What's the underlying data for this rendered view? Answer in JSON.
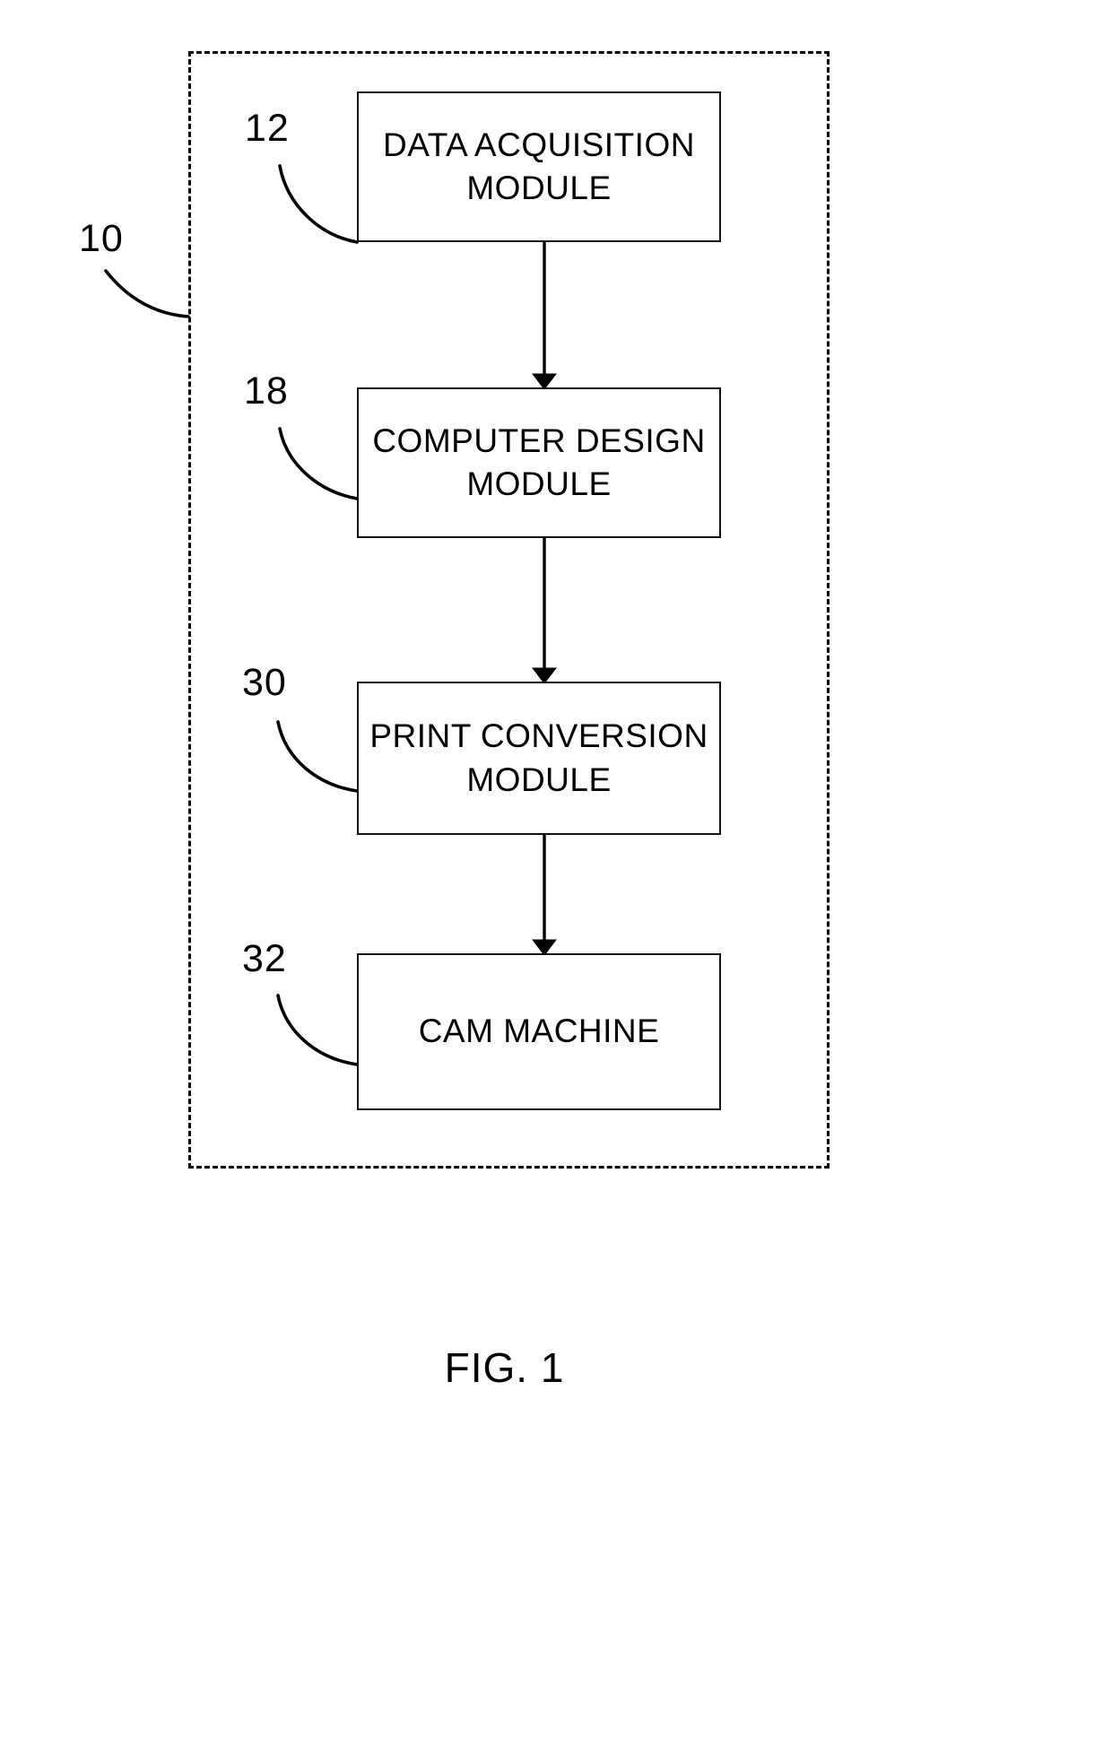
{
  "figure": {
    "caption": "FIG. 1",
    "system_reference": "10"
  },
  "diagram": {
    "type": "flowchart",
    "orientation": "vertical",
    "boundary": {
      "style": "dashed",
      "reference": "10",
      "description": "system boundary"
    },
    "nodes": [
      {
        "id": "data-acquisition",
        "reference": "12",
        "label": "DATA ACQUISITION\nMODULE"
      },
      {
        "id": "computer-design",
        "reference": "18",
        "label": "COMPUTER DESIGN\nMODULE"
      },
      {
        "id": "print-conversion",
        "reference": "30",
        "label": "PRINT CONVERSION\nMODULE"
      },
      {
        "id": "cam-machine",
        "reference": "32",
        "label": "CAM MACHINE"
      }
    ],
    "edges": [
      {
        "from": "data-acquisition",
        "to": "computer-design",
        "arrow": "down"
      },
      {
        "from": "computer-design",
        "to": "print-conversion",
        "arrow": "down"
      },
      {
        "from": "print-conversion",
        "to": "cam-machine",
        "arrow": "down"
      }
    ],
    "colors": {
      "line": "#000000",
      "background": "#ffffff",
      "text": "#000000"
    }
  }
}
